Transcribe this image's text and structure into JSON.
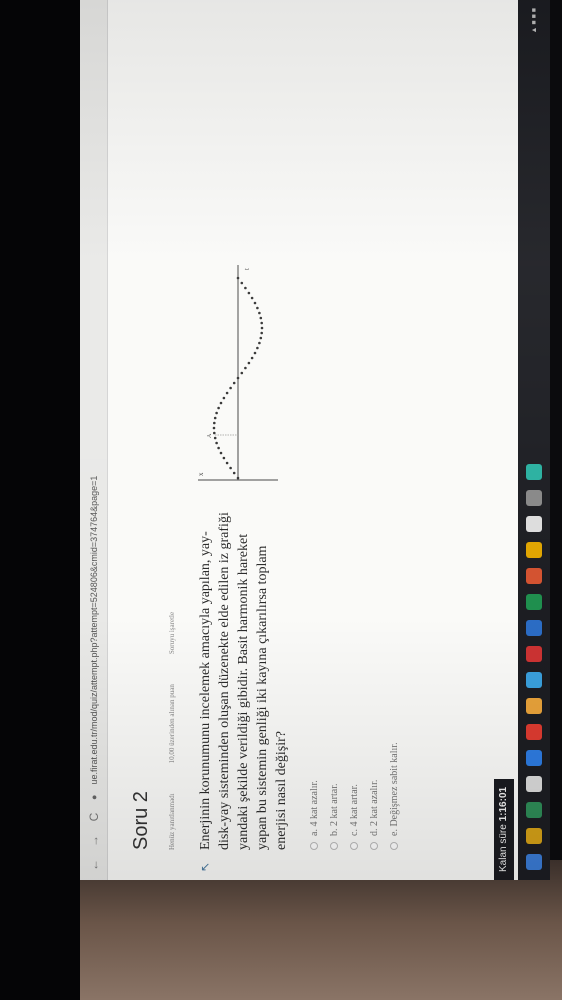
{
  "browser": {
    "url": "ue.firat.edu.tr/mod/quiz/attempt.php?attempt=524806&cmid=374764&page=1",
    "back_label": "←",
    "forward_label": "→",
    "reload_label": "C"
  },
  "question": {
    "title": "Soru 2",
    "status": "Henüz yanıtlanmadı",
    "points": "10,00 üzerinden alınan puan",
    "flag_label": "Soruyu işaretle",
    "text": "Enerjinin korunumunu incelemek amacıyla yapılan, yay-disk-yay sisteminden oluşan düzenekte elde edilen iz grafiği yandaki şekilde verildiği gibidir. Basit harmonik hareket yapan bu sistemin genliği iki kayına çıkarılırsa toplam enerjisi nasıl değişir?"
  },
  "options": [
    {
      "label": "a. 4 kat azalır."
    },
    {
      "label": "b. 2 kat artar."
    },
    {
      "label": "c. 4 kat artar."
    },
    {
      "label": "d. 2 kat azalır."
    },
    {
      "label": "e. Değişmez sabit kalır."
    }
  ],
  "graph": {
    "y_label": "x",
    "x_label": "t",
    "amp_label": "A"
  },
  "timer": {
    "label": "Kalan süre",
    "value": "1:16:01"
  },
  "colors": {
    "page_bg": "#fafaf8",
    "taskbar": "#1c1d22",
    "accent": "#4a7aa0"
  }
}
